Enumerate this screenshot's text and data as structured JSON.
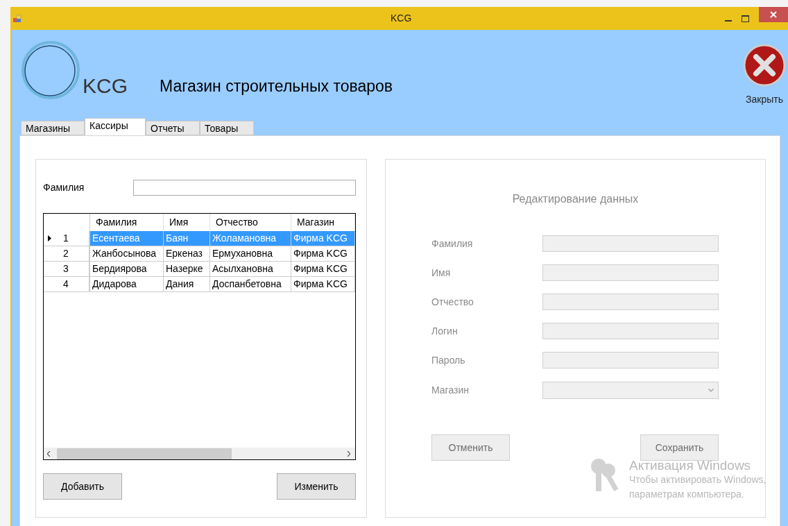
{
  "window": {
    "title": "KCG"
  },
  "header": {
    "logo_text": "KCG",
    "title": "Магазин строительных товаров",
    "close_label": "Закрыть"
  },
  "tabs": [
    {
      "label": "Магазины",
      "selected": false
    },
    {
      "label": "Кассиры",
      "selected": true
    },
    {
      "label": "Отчеты",
      "selected": false
    },
    {
      "label": "Товары",
      "selected": false
    }
  ],
  "search": {
    "label": "Фамилия"
  },
  "grid": {
    "columns": [
      "Фамилия",
      "Имя",
      "Отчество",
      "Магазин"
    ],
    "rows": [
      {
        "number": "1",
        "selected": true,
        "cells": [
          "Есентаева",
          "Баян",
          "Жоламановна",
          "Фирма KCG"
        ]
      },
      {
        "number": "2",
        "selected": false,
        "cells": [
          "Жанбосынова",
          "Еркеназ",
          "Ермухановна",
          "Фирма KCG"
        ]
      },
      {
        "number": "3",
        "selected": false,
        "cells": [
          "Бердиярова",
          "Назерке",
          "Асылхановна",
          "Фирма KCG"
        ]
      },
      {
        "number": "4",
        "selected": false,
        "cells": [
          "Дидарова",
          "Дания",
          "Доспанбетовна",
          "Фирма KCG"
        ]
      }
    ]
  },
  "buttons": [
    "Добавить",
    "Изменить"
  ],
  "edit_panel": {
    "disabled": true,
    "title": "Редактирование данных",
    "fields": [
      {
        "label": "Фамилия",
        "kind": "text"
      },
      {
        "label": "Имя",
        "kind": "text"
      },
      {
        "label": "Отчество",
        "kind": "text"
      },
      {
        "label": "Логин",
        "kind": "text"
      },
      {
        "label": "Пароль",
        "kind": "text"
      },
      {
        "label": "Магазин",
        "kind": "select"
      }
    ],
    "buttons": [
      "Отменить",
      "Сохранить"
    ]
  },
  "activation_notice": {
    "title": "Активация Windows",
    "lines": [
      "Чтобы активировать Windows,",
      "параметрам компьютера."
    ]
  }
}
